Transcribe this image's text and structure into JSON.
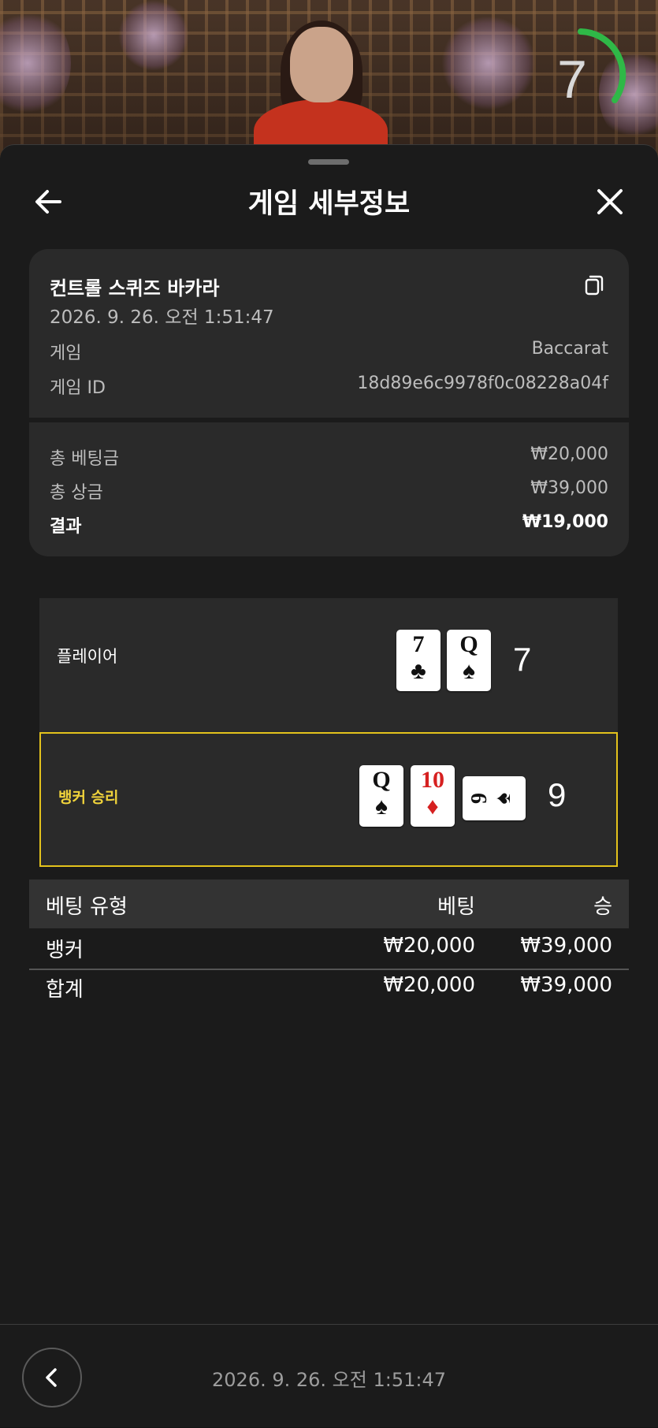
{
  "stream": {
    "timer": "7",
    "colors": {
      "timer_arc": "#2fb847"
    }
  },
  "header": {
    "title": "게임 세부정보",
    "back_icon": "arrow-left-icon",
    "close_icon": "close-icon"
  },
  "summary": {
    "game_name": "컨트롤 스퀴즈 바카라",
    "datetime": "2026. 9. 26. 오전 1:51:47",
    "rows": [
      {
        "label": "게임",
        "value": "Baccarat"
      },
      {
        "label": "게임 ID",
        "value": "18d89e6c9978f0c08228a04f"
      }
    ],
    "totals": [
      {
        "label": "총 베팅금",
        "value": "₩20,000"
      },
      {
        "label": "총 상금",
        "value": "₩39,000"
      },
      {
        "label": "결과",
        "value": "₩19,000"
      }
    ]
  },
  "hands": {
    "player": {
      "label": "플레이어",
      "score": "7",
      "cards": [
        {
          "rank": "7",
          "suit": "♣",
          "color": "black"
        },
        {
          "rank": "Q",
          "suit": "♠",
          "color": "black"
        }
      ]
    },
    "banker": {
      "label": "뱅커 승리",
      "score": "9",
      "cards": [
        {
          "rank": "Q",
          "suit": "♠",
          "color": "black"
        },
        {
          "rank": "10",
          "suit": "♦",
          "color": "red"
        },
        {
          "rank": "9",
          "suit": "♠",
          "color": "black",
          "rotated": true
        }
      ],
      "colors": {
        "highlight": "#e3c21c"
      }
    }
  },
  "bets_table": {
    "headers": [
      "베팅 유형",
      "베팅",
      "승"
    ],
    "rows": [
      [
        "뱅커",
        "₩20,000",
        "₩39,000"
      ],
      [
        "합계",
        "₩20,000",
        "₩39,000"
      ]
    ]
  },
  "footer": {
    "datetime": "2026. 9. 26. 오전 1:51:47",
    "prev_icon": "chevron-left-icon"
  }
}
